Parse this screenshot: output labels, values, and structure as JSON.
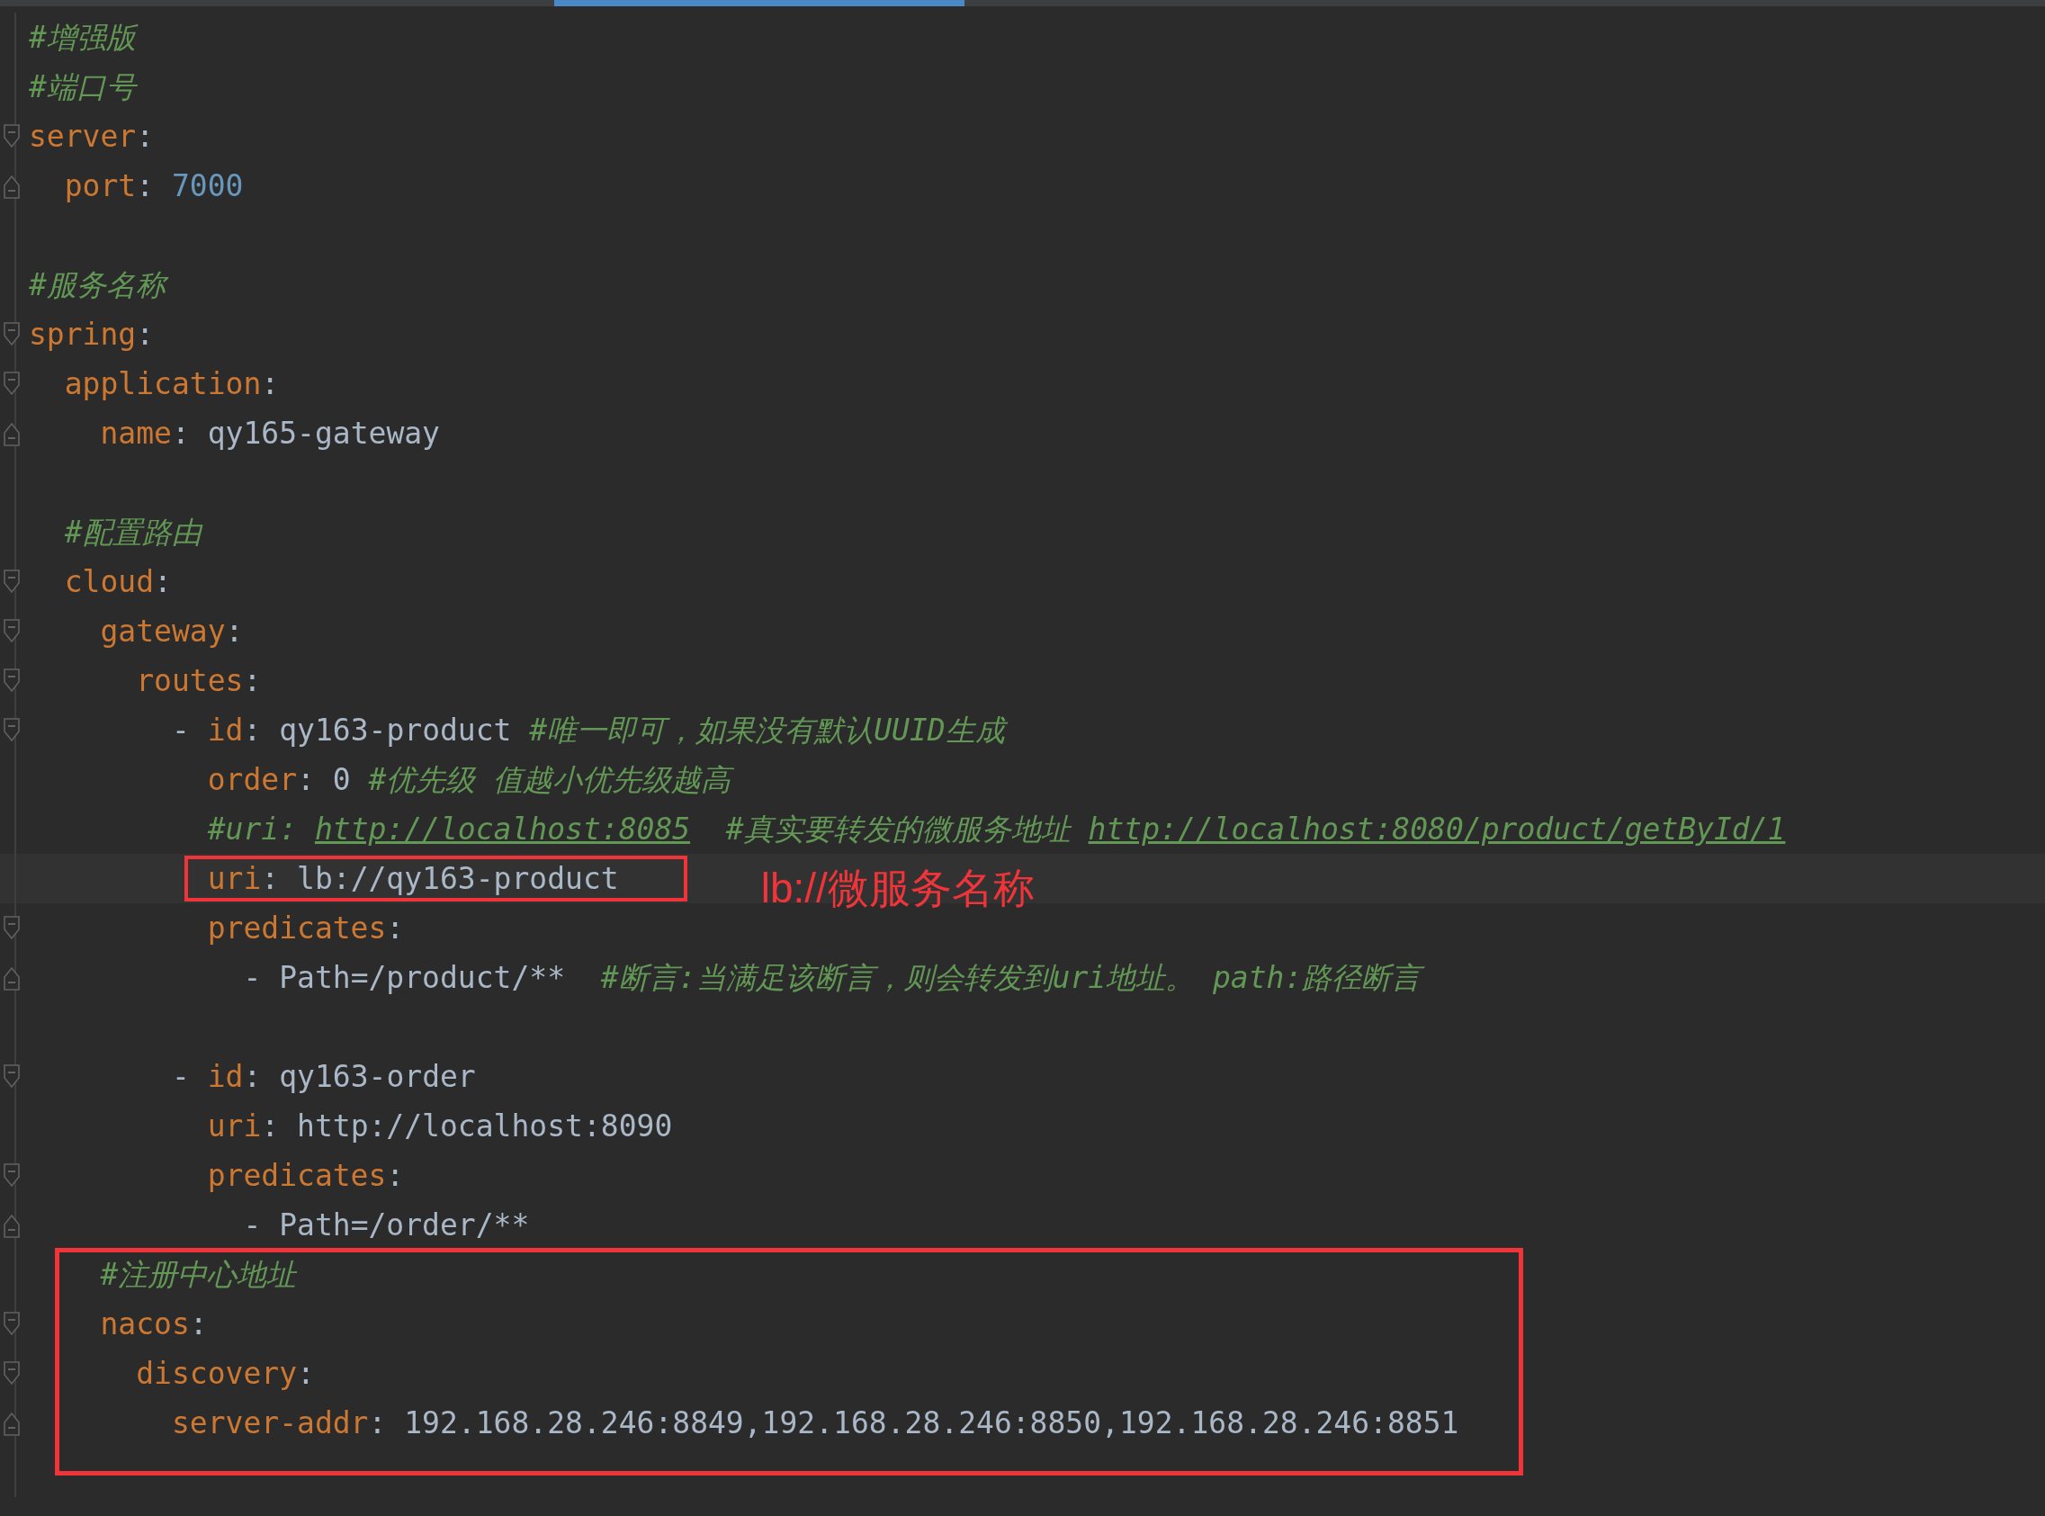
{
  "editor": {
    "blocks": [
      {
        "boxed": false,
        "lines": [
          {
            "tokens": [
              {
                "kind": "comment",
                "text": "#增强版"
              }
            ]
          },
          {
            "tokens": [
              {
                "kind": "comment",
                "text": "#端口号"
              }
            ]
          },
          {
            "fold_start": true,
            "tokens": [
              {
                "kind": "key",
                "text": "server"
              },
              {
                "kind": "punct",
                "text": ":"
              }
            ]
          },
          {
            "fold_end": true,
            "tokens": [
              {
                "kind": "key",
                "text": "  port"
              },
              {
                "kind": "punct",
                "text": ": "
              },
              {
                "kind": "number",
                "text": "7000"
              }
            ]
          },
          {
            "blank": true
          },
          {
            "tokens": [
              {
                "kind": "comment",
                "text": "#服务名称"
              }
            ]
          },
          {
            "fold_start": true,
            "tokens": [
              {
                "kind": "key",
                "text": "spring"
              },
              {
                "kind": "punct",
                "text": ":"
              }
            ]
          },
          {
            "fold_start": true,
            "tokens": [
              {
                "kind": "key",
                "text": "  application"
              },
              {
                "kind": "punct",
                "text": ":"
              }
            ]
          },
          {
            "fold_end": true,
            "tokens": [
              {
                "kind": "key",
                "text": "    name"
              },
              {
                "kind": "punct",
                "text": ": "
              },
              {
                "kind": "value",
                "text": "qy165-gateway"
              }
            ]
          },
          {
            "blank": true
          },
          {
            "tokens": [
              {
                "kind": "comment",
                "text": "  #配置路由"
              }
            ]
          },
          {
            "fold_start": true,
            "tokens": [
              {
                "kind": "key",
                "text": "  cloud"
              },
              {
                "kind": "punct",
                "text": ":"
              }
            ]
          },
          {
            "fold_start": true,
            "tokens": [
              {
                "kind": "key",
                "text": "    gateway"
              },
              {
                "kind": "punct",
                "text": ":"
              }
            ]
          },
          {
            "fold_start": true,
            "tokens": [
              {
                "kind": "key",
                "text": "      routes"
              },
              {
                "kind": "punct",
                "text": ":"
              }
            ]
          },
          {
            "fold_start": true,
            "tokens": [
              {
                "kind": "punct",
                "text": "        - "
              },
              {
                "kind": "key",
                "text": "id"
              },
              {
                "kind": "punct",
                "text": ": "
              },
              {
                "kind": "value",
                "text": "qy163-product "
              },
              {
                "kind": "comment",
                "text": "#唯一即可，如果没有默认UUID生成"
              }
            ]
          },
          {
            "tokens": [
              {
                "kind": "key",
                "text": "          order"
              },
              {
                "kind": "punct",
                "text": ": "
              },
              {
                "kind": "value",
                "text": "0 "
              },
              {
                "kind": "comment",
                "text": "#优先级 值越小优先级越高"
              }
            ]
          },
          {
            "tokens": [
              {
                "kind": "comment",
                "text": "          #uri: "
              },
              {
                "kind": "link",
                "text": "http://localhost:8085"
              },
              {
                "kind": "comment",
                "text": "  #真实要转发的微服务地址 "
              },
              {
                "kind": "link",
                "text": "http://localhost:8080/product/getById/1"
              }
            ]
          },
          {
            "current": true,
            "boxed": true,
            "note": "lb://微服务名称",
            "tokens": [
              {
                "kind": "key",
                "text": "uri"
              },
              {
                "kind": "punct",
                "text": ": "
              },
              {
                "kind": "value",
                "text": "lb://qy163-product"
              }
            ]
          },
          {
            "fold_start": true,
            "tokens": [
              {
                "kind": "key",
                "text": "          predicates"
              },
              {
                "kind": "punct",
                "text": ":"
              }
            ]
          },
          {
            "fold_end": true,
            "tokens": [
              {
                "kind": "punct",
                "text": "            - "
              },
              {
                "kind": "value",
                "text": "Path=/product/**  "
              },
              {
                "kind": "comment",
                "text": "#断言:当满足该断言，则会转发到uri地址。 path:路径断言"
              }
            ]
          },
          {
            "blank": true
          },
          {
            "fold_start": true,
            "tokens": [
              {
                "kind": "punct",
                "text": "        - "
              },
              {
                "kind": "key",
                "text": "id"
              },
              {
                "kind": "punct",
                "text": ": "
              },
              {
                "kind": "value",
                "text": "qy163-order"
              }
            ]
          },
          {
            "tokens": [
              {
                "kind": "key",
                "text": "          uri"
              },
              {
                "kind": "punct",
                "text": ": "
              },
              {
                "kind": "value",
                "text": "http://localhost:8090"
              }
            ]
          },
          {
            "fold_start": true,
            "tokens": [
              {
                "kind": "key",
                "text": "          predicates"
              },
              {
                "kind": "punct",
                "text": ":"
              }
            ]
          },
          {
            "fold_end": true,
            "tokens": [
              {
                "kind": "punct",
                "text": "            - "
              },
              {
                "kind": "value",
                "text": "Path=/order/**"
              }
            ]
          }
        ]
      },
      {
        "boxed": true,
        "lines": [
          {
            "tokens": [
              {
                "kind": "comment",
                "text": "    #注册中心地址"
              }
            ]
          },
          {
            "fold_start": true,
            "tokens": [
              {
                "kind": "key",
                "text": "    nacos"
              },
              {
                "kind": "punct",
                "text": ":"
              }
            ]
          },
          {
            "fold_start": true,
            "tokens": [
              {
                "kind": "key",
                "text": "      discovery"
              },
              {
                "kind": "punct",
                "text": ":"
              }
            ]
          },
          {
            "fold_end": true,
            "tokens": [
              {
                "kind": "key",
                "text": "        server-addr"
              },
              {
                "kind": "punct",
                "text": ": "
              },
              {
                "kind": "value",
                "text": "192.168.28.246:8849,192.168.28.246:8850,192.168.28.246:8851"
              }
            ]
          },
          {
            "blank": true
          }
        ]
      }
    ]
  }
}
